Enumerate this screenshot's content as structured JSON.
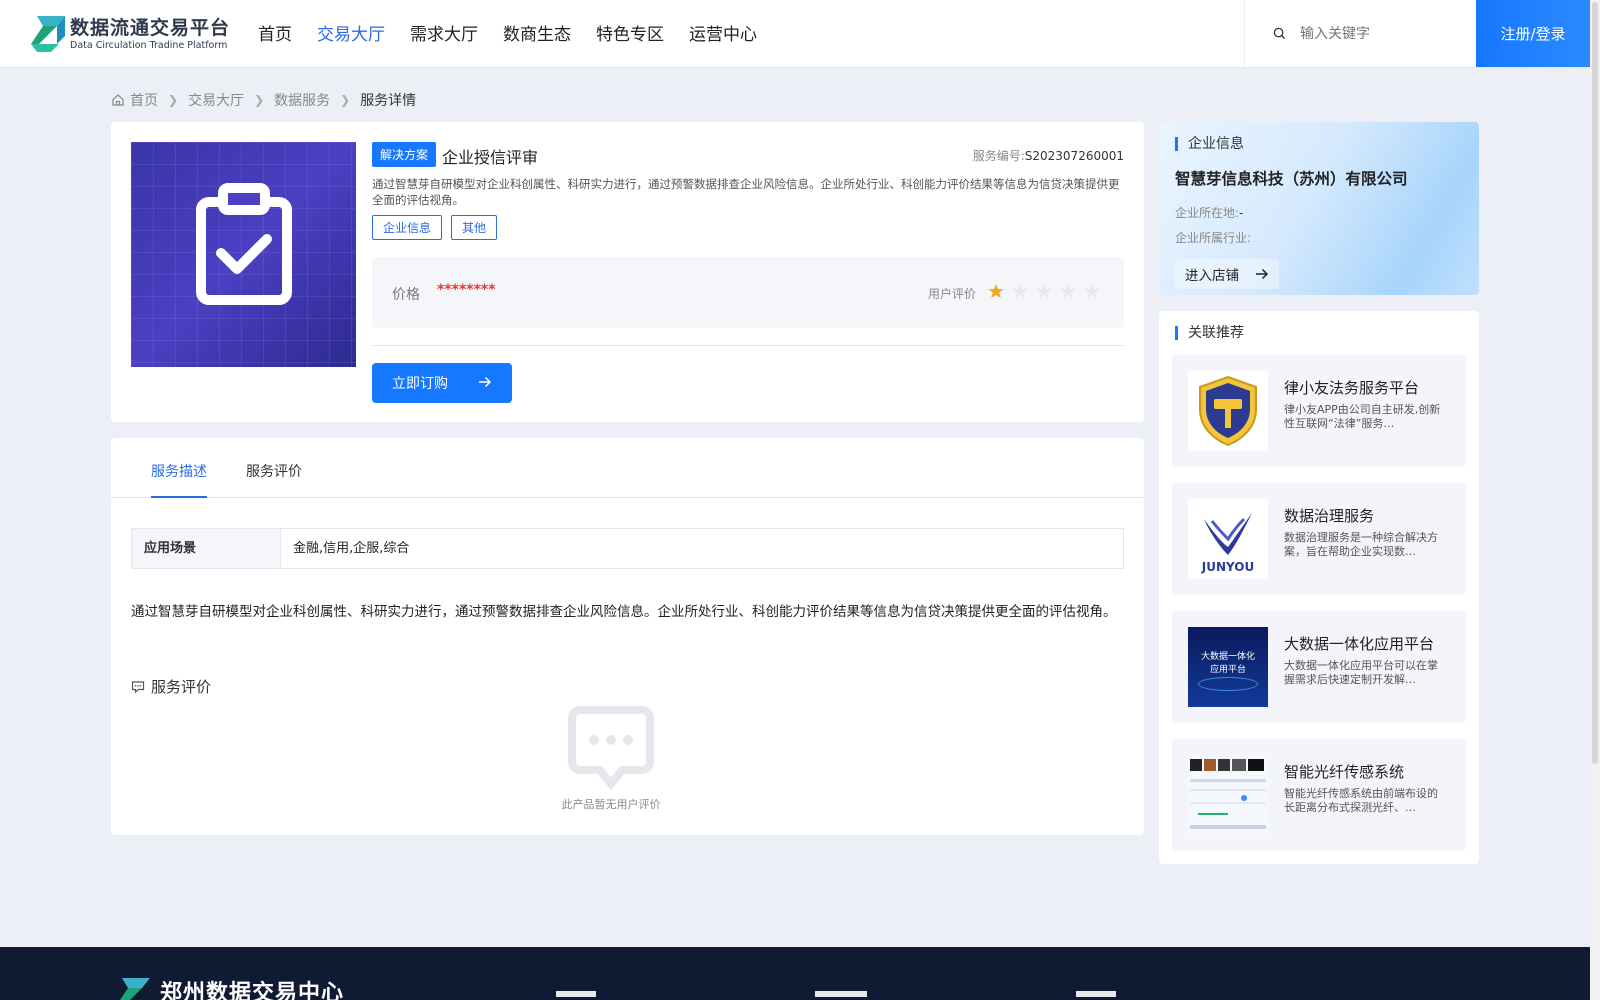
{
  "header": {
    "logo_cn": "数据流通交易平台",
    "logo_en": "Data Circulation Tradine Platform",
    "nav": [
      "首页",
      "交易大厅",
      "需求大厅",
      "数商生态",
      "特色专区",
      "运营中心"
    ],
    "active_nav": "交易大厅",
    "search_placeholder": "输入关键字",
    "login_label": "注册/登录"
  },
  "breadcrumb": [
    "首页",
    "交易大厅",
    "数据服务",
    "服务详情"
  ],
  "product": {
    "type_tag": "解决方案",
    "title": "企业授信评审",
    "service_no_label": "服务编号:",
    "service_no": "S202307260001",
    "description": "通过智慧芽自研模型对企业科创属性、科研实力进行，通过预警数据排查企业风险信息。企业所处行业、科创能力评价结果等信息为信贷决策提供更全面的评估视角。",
    "tags": [
      "企业信息",
      "其他"
    ],
    "price_label": "价格",
    "price_value": "********",
    "rating_label": "用户评价",
    "rating": 1,
    "rating_max": 5,
    "buy_label": "立即订购"
  },
  "tabs": [
    "服务描述",
    "服务评价"
  ],
  "active_tab": "服务描述",
  "spec": {
    "key": "应用场景",
    "value": "金融,信用,企服,综合"
  },
  "detail_text": "通过智慧芽自研模型对企业科创属性、科研实力进行，通过预警数据排查企业风险信息。企业所处行业、科创能力评价结果等信息为信贷决策提供更全面的评估视角。",
  "review": {
    "title": "服务评价",
    "empty_text": "此产品暂无用户评价"
  },
  "company": {
    "section_title": "企业信息",
    "name": "智慧芽信息科技（苏州）有限公司",
    "location_label": "企业所在地:",
    "location_value": "-",
    "industry_label": "企业所属行业:",
    "industry_value": "",
    "store_label": "进入店铺"
  },
  "related": {
    "section_title": "关联推荐",
    "items": [
      {
        "title": "律小友法务服务平台",
        "desc": "律小友APP由公司自主研发,创新性互联网“法律”服务…"
      },
      {
        "title": "数据治理服务",
        "desc": "数据治理服务是一种综合解决方案，旨在帮助企业实现数…",
        "logo_text": "JUNYOU"
      },
      {
        "title": "大数据一体化应用平台",
        "desc": "大数据一体化应用平台可以在掌握需求后快速定制开发解…",
        "thumb_text": "大数据一体化应用平台"
      },
      {
        "title": "智能光纤传感系统",
        "desc": "智能光纤传感系统由前端布设的长距离分布式探测光纤、…"
      }
    ]
  },
  "footer": {
    "title": "郑州数据交易中心"
  },
  "colors": {
    "primary": "#1677ff",
    "price": "#e53935",
    "star": "#f5a623",
    "footer": "#0f1a33"
  }
}
